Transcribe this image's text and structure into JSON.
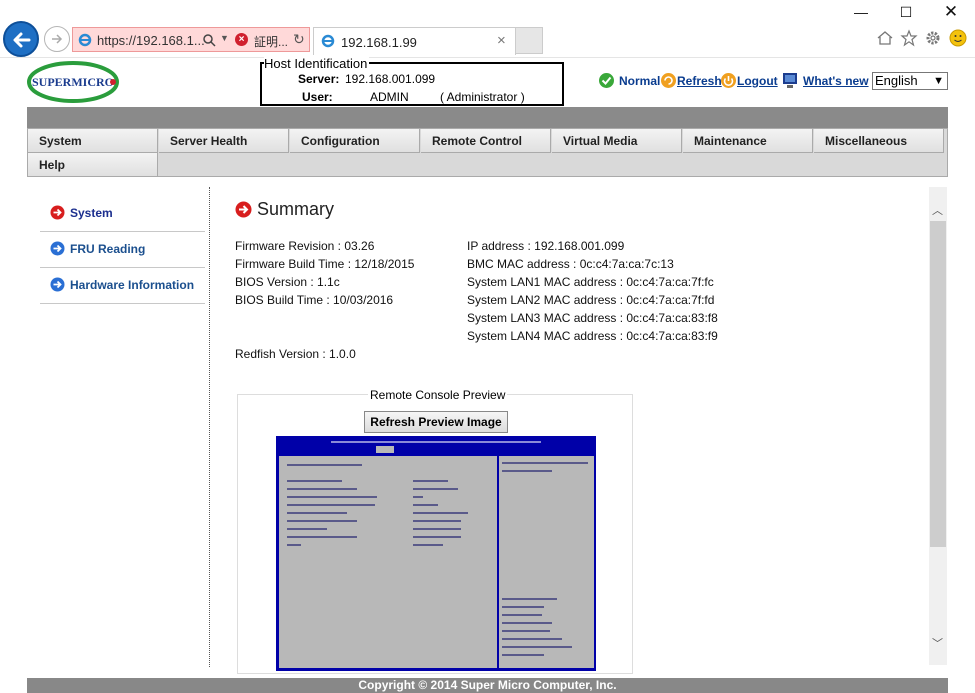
{
  "browser": {
    "url": "https://192.168.1...",
    "cert_label": "証明...",
    "tab_title": "192.168.1.99"
  },
  "host_identification": {
    "legend": "Host Identification",
    "server_label": "Server:",
    "server_value": "192.168.001.099",
    "user_label": "User:",
    "user_value": "ADMIN",
    "user_role": "( Administrator )"
  },
  "logo_text": "SUPERMICRO",
  "status": {
    "normal": "Normal",
    "refresh": "Refresh",
    "logout": "Logout",
    "whats_new": "What's  new"
  },
  "language": {
    "selected": "English"
  },
  "menu": {
    "items": [
      "System",
      "Server Health",
      "Configuration",
      "Remote Control",
      "Virtual Media",
      "Maintenance",
      "Miscellaneous"
    ],
    "row2": [
      "Help"
    ]
  },
  "leftnav": {
    "items": [
      "System",
      "FRU Reading",
      "Hardware Information"
    ]
  },
  "summary": {
    "title": "Summary",
    "left": [
      "Firmware Revision :  03.26",
      "Firmware Build Time :  12/18/2015",
      "BIOS Version : 1.1c",
      "BIOS Build Time : 10/03/2016"
    ],
    "redfish": "Redfish Version : 1.0.0",
    "right": [
      "IP address :  192.168.001.099",
      "BMC MAC address :  0c:c4:7a:ca:7c:13",
      "System LAN1 MAC address : 0c:c4:7a:ca:7f:fc",
      "System LAN2 MAC address : 0c:c4:7a:ca:7f:fd",
      "System LAN3 MAC address : 0c:c4:7a:ca:83:f8",
      "System LAN4 MAC address : 0c:c4:7a:ca:83:f9"
    ]
  },
  "preview": {
    "legend": "Remote Console Preview",
    "button": "Refresh Preview Image"
  },
  "footer": "Copyright © 2014 Super Micro Computer, Inc.",
  "colors": {
    "accent": "#1b4f8e",
    "menu_bar": "#8a8a8a",
    "footer": "#888888",
    "console_bg": "#0000a8"
  }
}
